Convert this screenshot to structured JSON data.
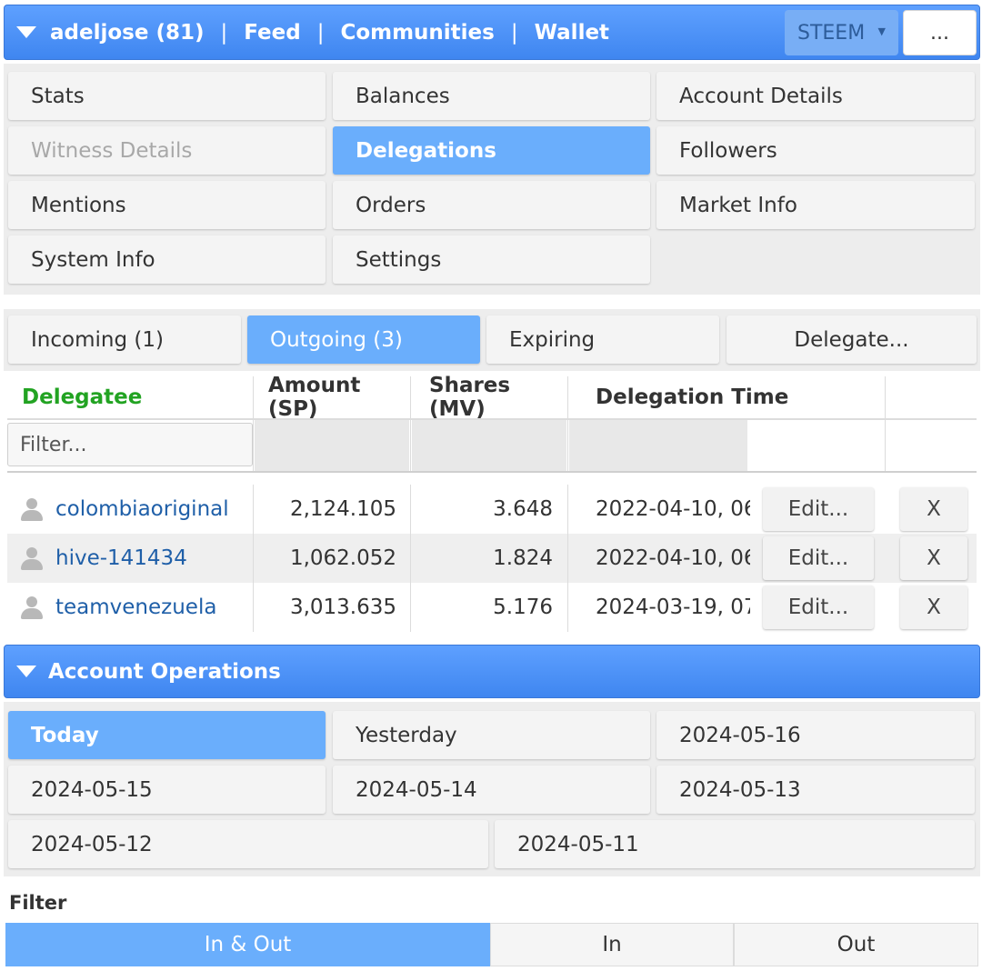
{
  "topbar": {
    "nav": [
      "adeljose (81)",
      "Feed",
      "Communities",
      "Wallet"
    ],
    "chain_select": "STEEM",
    "more_label": "..."
  },
  "menu": {
    "items": [
      "Stats",
      "Balances",
      "Account Details",
      "Witness Details",
      "Delegations",
      "Followers",
      "Mentions",
      "Orders",
      "Market Info",
      "System Info",
      "Settings"
    ],
    "active": "Delegations",
    "disabled": "Witness Details"
  },
  "deleg_tabs": {
    "items": [
      "Incoming (1)",
      "Outgoing (3)",
      "Expiring",
      "Delegate..."
    ],
    "active": "Outgoing (3)"
  },
  "table": {
    "headers": [
      "Delegatee",
      "Amount (SP)",
      "Shares (MV)",
      "Delegation Time"
    ],
    "filter_placeholder": "Filter...",
    "edit_label": "Edit...",
    "remove_label": "X",
    "rows": [
      {
        "delegatee": "colombiaoriginal",
        "amount": "2,124.105",
        "shares": "3.648",
        "time": "2022-04-10, 06:"
      },
      {
        "delegatee": "hive-141434",
        "amount": "1,062.052",
        "shares": "1.824",
        "time": "2022-04-10, 06:"
      },
      {
        "delegatee": "teamvenezuela",
        "amount": "3,013.635",
        "shares": "5.176",
        "time": "2024-03-19, 07:"
      }
    ]
  },
  "ops": {
    "title": "Account Operations",
    "days": [
      "Today",
      "Yesterday",
      "2024-05-16",
      "2024-05-15",
      "2024-05-14",
      "2024-05-13",
      "2024-05-12",
      "2024-05-11"
    ],
    "active_day": "Today",
    "filter_label": "Filter",
    "filter_options": [
      "In & Out",
      "In",
      "Out"
    ],
    "active_filter": "In & Out"
  },
  "colors": {
    "header_blue": "#4a90f5",
    "active_blue": "#6aaefc",
    "delegatee_green": "#22a322",
    "link_blue": "#1f5fa8"
  },
  "icons": [
    "triangle-down-icon",
    "dropdown-caret-icon",
    "user-icon"
  ]
}
